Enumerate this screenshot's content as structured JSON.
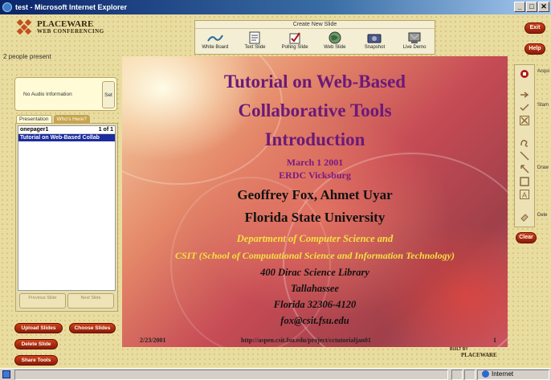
{
  "window": {
    "title": "test - Microsoft Internet Explorer",
    "controls": [
      "_",
      "□",
      "✕"
    ]
  },
  "brand": {
    "name": "PLACEWARE",
    "tagline": "WEB CONFERENCING"
  },
  "presence": {
    "text": "2 people present"
  },
  "toolbar": {
    "title": "Create New Slide",
    "tools": [
      {
        "label": "White Board",
        "icon": "whiteboard-icon"
      },
      {
        "label": "Text Slide",
        "icon": "text-slide-icon"
      },
      {
        "label": "Polling Slide",
        "icon": "polling-slide-icon"
      },
      {
        "label": "Web Slide",
        "icon": "web-slide-icon"
      },
      {
        "label": "Snapshot",
        "icon": "camera-icon"
      },
      {
        "label": "Live Demo",
        "icon": "live-demo-icon"
      }
    ]
  },
  "top_buttons": {
    "exit": "Exit",
    "help": "Help",
    "clear": "Clear"
  },
  "audio": {
    "text": "No Audio Information",
    "set_label": "Set"
  },
  "tabs": [
    {
      "label": "Presentation",
      "active": true
    },
    {
      "label": "Who's Here?",
      "active": false
    }
  ],
  "slide_list": {
    "name": "onepager1",
    "count": "1 of 1",
    "items": [
      "Tutorial on Web-Based Collab"
    ],
    "prev_label": "Previous Slide",
    "next_label": "Next Slide"
  },
  "left_buttons": {
    "upload": "Upload Slides",
    "choose": "Choose Slides",
    "delete": "Delete Slide",
    "share": "Share Tools"
  },
  "slide": {
    "title_lines": [
      "Tutorial on Web-Based",
      "Collaborative Tools",
      "Introduction"
    ],
    "date": "March 1 2001",
    "location": "ERDC Vicksburg",
    "authors": "Geoffrey Fox, Ahmet Uyar",
    "university": "Florida State University",
    "dept_line1": "Department of Computer Science and",
    "dept_line2": "CSIT (School of Computational Science and Information Technology)",
    "addr_line1": "400 Dirac Science Library",
    "addr_line2": "Tallahassee",
    "addr_line3": "Florida 32306-4120",
    "email": "fox@csit.fsu.edu",
    "footer_date": "2/23/2001",
    "footer_url": "http://aspen.csit.fsu.edu/project/cctutorialjan01",
    "footer_page": "1"
  },
  "right_tools": {
    "labels": {
      "acquire": "Acqui",
      "stamp": "Stam",
      "draw": "Draw",
      "delete": "Dele"
    }
  },
  "built_by": {
    "prefix": "BUILT BY",
    "name": "PLACEWARE"
  },
  "statusbar": {
    "zone": "Internet"
  }
}
